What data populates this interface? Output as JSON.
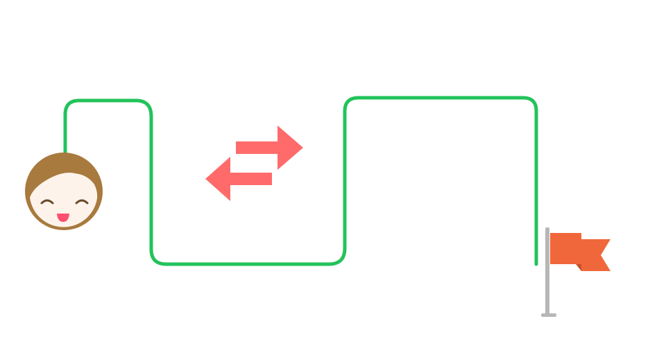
{
  "diagram": {
    "colors": {
      "background": "#ffffff",
      "path": "#22c35a",
      "arrows": "#ff6b6b",
      "face_hair": "#a87a3e",
      "face_skin": "#fdf3ea",
      "face_features": "#6b4a2b",
      "face_mouth": "#ff4f6e",
      "flag": "#f0673b",
      "flag_fold": "#c94f26",
      "flag_pole": "#b7b7b7"
    },
    "icons": {
      "start": "smiling-face-icon",
      "middle": "swap-arrows-icon",
      "end": "flag-icon"
    }
  }
}
